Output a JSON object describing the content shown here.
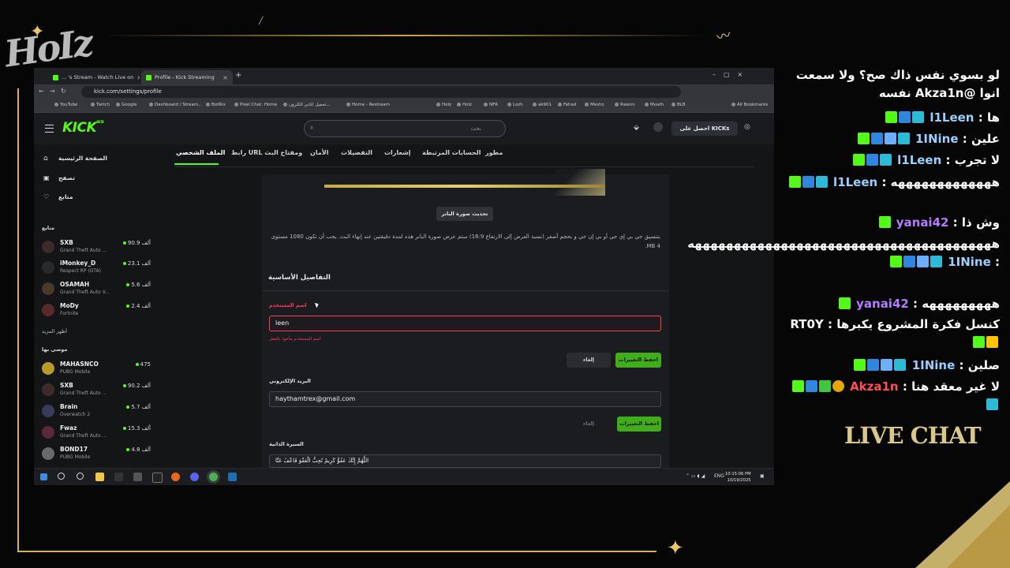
{
  "overlay": {
    "logo_text": "HoIz",
    "live_chat_label": "LIVE CHAT"
  },
  "browser": {
    "tabs": [
      {
        "label": "... 's Stream - Watch Live on",
        "active": false
      },
      {
        "label": "Profile - Kick Streaming",
        "active": true
      }
    ],
    "url": "kick.com/settings/profile",
    "bookmarks": [
      "YouTube",
      "Twitch",
      "Google",
      "Dashboard / Stream...",
      "BotRix",
      "Pixel Chat: Home",
      "تحميل اغاني الكترون...",
      "Home - Restream",
      "",
      "HoIz",
      "HoIz",
      "NFR",
      "Lozh",
      "ak901",
      "Fahad",
      "Meshz",
      "Rwenn",
      "Muath",
      "BLB",
      "All Bookmarks"
    ]
  },
  "kick": {
    "logo": "KICK",
    "logo_badge": "BETA",
    "search_placeholder": "بحث",
    "get_kicks": "احصل على KICKs",
    "sidebar": {
      "nav": [
        {
          "label": "الصفحة الرئيسية",
          "icon": "home-icon"
        },
        {
          "label": "تصفح",
          "icon": "browse-icon"
        },
        {
          "label": "متابع",
          "icon": "heart-icon"
        }
      ],
      "following_title": "متابع",
      "following": [
        {
          "name": "SXB",
          "game": "Grand Theft Auto ...",
          "viewers": "90.9 ألف",
          "avatar_color": "#3d2a2a"
        },
        {
          "name": "iMonkey_D",
          "game": "Respect RP (GTA)",
          "viewers": "23.1 ألف",
          "avatar_color": "#2a2a2a"
        },
        {
          "name": "OSAMAH",
          "game": "Grand Theft Auto V...",
          "viewers": "5.6 ألف",
          "avatar_color": "#4a3a2a"
        },
        {
          "name": "MoDy",
          "game": "Fortnite",
          "viewers": "2.4 ألف",
          "avatar_color": "#5a2a2a"
        }
      ],
      "show_more": "أظهر المزيد",
      "recommended_title": "موصى بها",
      "recommended": [
        {
          "name": "MAHASNCO",
          "game": "PUBG Mobile",
          "viewers": "475",
          "avatar_color": "#b89a2a"
        },
        {
          "name": "SXB",
          "game": "Grand Theft Auto ...",
          "viewers": "90.2 ألف",
          "avatar_color": "#3d2a2a"
        },
        {
          "name": "Brain",
          "game": "Overwatch 2",
          "viewers": "5.7 ألف",
          "avatar_color": "#3a3a5a"
        },
        {
          "name": "Fwaz",
          "game": "Grand Theft Auto ...",
          "viewers": "15.3 ألف",
          "avatar_color": "#5a2a3a"
        },
        {
          "name": "BOND17",
          "game": "PUBG Mobile",
          "viewers": "4.8 ألف",
          "avatar_color": "#6a6a6a"
        }
      ]
    },
    "settings_tabs": [
      "مطور",
      "الحسابات المرتبطة",
      "إشعارات",
      "التفضيلات",
      "الأمان",
      "رابط URL ومفتاح البث",
      "الملف الشخصي"
    ],
    "banner_button": "تحديث صورة البانر",
    "banner_note": "بتنسيق جي بي إي جي أو بي إن جي و بحجم أصغر (نسبة العرض إلى الارتفاع 16:9) ستم عرض صورة البانر هذه لمدة دقيقتين عند إنهاء البث. يجب أن تكون 1080 مستوى 4 MB.",
    "section_title": "التفاصيل الأساسية",
    "username": {
      "label": "اسم المستخدم",
      "value": "leen",
      "error": "اسم المستخدم مأخوذ بالفعل"
    },
    "email": {
      "label": "البريد الإلكتروني",
      "value": "haythamtrex@gmail.com"
    },
    "bio_label": "السيرة الذاتية",
    "bio_value": "اللَّهُمَّ إِنَّكَ عَفُوٌّ كَرِيمٌ تُحِبُّ الْعَفْوَ فَاعْفُ عَنَّا",
    "save_label": "احفظ التغييرات",
    "cancel_label": "إلغاء"
  },
  "taskbar": {
    "lang": "ENG",
    "time": "10:15:06 PM",
    "date": "10/19/2025"
  },
  "chat": {
    "messages": [
      {
        "user": "",
        "text": "لو بسوي نفس ذاك صح؟ ولا سمعت انوا @Akza1n نفسه",
        "color": "",
        "badges": []
      },
      {
        "user": "l1Leen",
        "text": "ها",
        "color": "",
        "badges": [
          "k",
          "g",
          "s"
        ]
      },
      {
        "user": "1INine",
        "text": "علين",
        "color": "",
        "badges": [
          "k",
          "g",
          "w",
          "s"
        ]
      },
      {
        "user": "l1Leen",
        "text": "لا تجرب",
        "color": "",
        "badges": [
          "k",
          "g",
          "s"
        ]
      },
      {
        "user": "l1Leen",
        "text": "هههههههههههههه",
        "color": "",
        "badges": [
          "k",
          "g",
          "s"
        ]
      },
      {
        "user": "yanai42",
        "text": "وش ذا",
        "color": "p",
        "badges": [
          "k"
        ]
      },
      {
        "user": "1INine",
        "text": "هههههههههههههههههههههههههههههههههههههههه",
        "color": "",
        "badges": [
          "k",
          "g",
          "w",
          "s"
        ]
      },
      {
        "user": "yanai42",
        "text": "هههههههههه",
        "color": "p",
        "badges": [
          "k"
        ]
      },
      {
        "user": "RT0Y",
        "text": "كنسل فكرة المشروع يكبرها",
        "color": "",
        "badges": [
          "k",
          "y"
        ]
      },
      {
        "user": "1INine",
        "text": "صلين",
        "color": "",
        "badges": [
          "k",
          "g",
          "w",
          "s"
        ]
      },
      {
        "user": "Akza1n",
        "text": "لا غير معقد هنا",
        "color": "r",
        "badges": [
          "k",
          "g",
          "c",
          "o",
          "s"
        ]
      }
    ]
  }
}
